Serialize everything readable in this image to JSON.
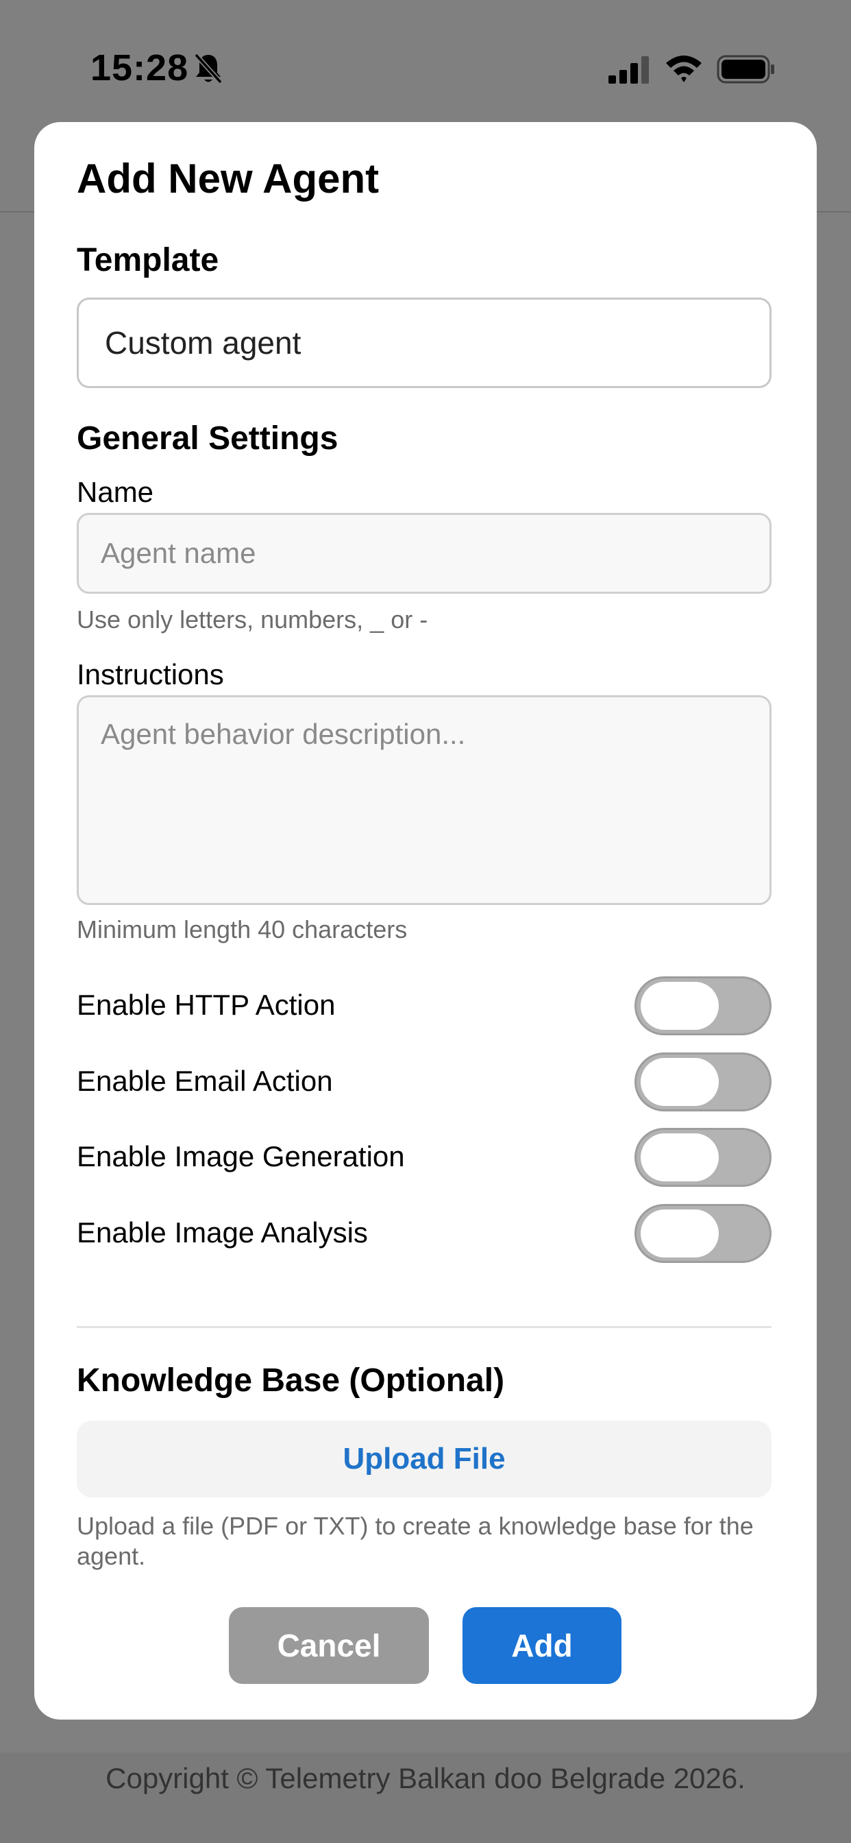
{
  "status_bar": {
    "time": "15:28"
  },
  "footer": {
    "copyright": "Copyright © Telemetry Balkan doo Belgrade 2026."
  },
  "modal": {
    "title": "Add New Agent",
    "template": {
      "label": "Template",
      "value": "Custom agent"
    },
    "general_settings": {
      "label": "General Settings",
      "name": {
        "label": "Name",
        "placeholder": "Agent name",
        "hint": "Use only letters, numbers, _ or -"
      },
      "instructions": {
        "label": "Instructions",
        "placeholder": "Agent behavior description...",
        "hint": "Minimum length 40 characters"
      }
    },
    "toggles": [
      {
        "label": "Enable HTTP Action",
        "enabled": false
      },
      {
        "label": "Enable Email Action",
        "enabled": false
      },
      {
        "label": "Enable Image Generation",
        "enabled": false
      },
      {
        "label": "Enable Image Analysis",
        "enabled": false
      }
    ],
    "knowledge_base": {
      "label": "Knowledge Base (Optional)",
      "upload_label": "Upload File",
      "hint": "Upload a file (PDF or TXT) to create a knowledge base for the agent."
    },
    "actions": {
      "cancel_label": "Cancel",
      "add_label": "Add"
    }
  },
  "colors": {
    "primary": "#1b74d6",
    "link": "#1f73c9",
    "cancel": "#9a9a9a",
    "backdrop": "#808080"
  },
  "icons": [
    "bell-slash-icon",
    "cellular-signal-icon",
    "wifi-icon",
    "battery-icon"
  ]
}
